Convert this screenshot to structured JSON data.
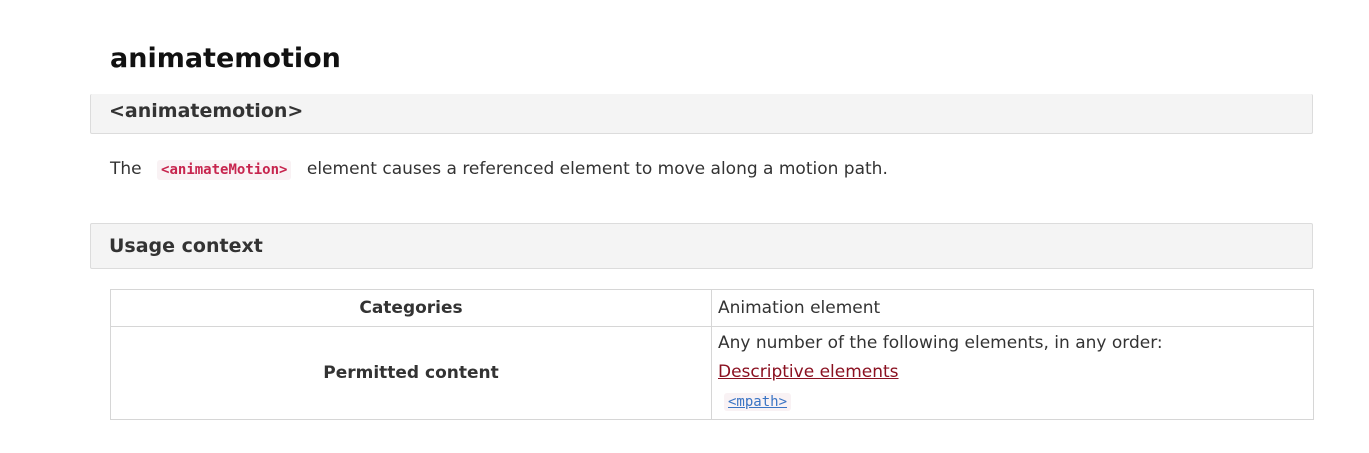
{
  "page": {
    "title": "animatemotion"
  },
  "section1": {
    "heading": "<animatemotion>"
  },
  "intro": {
    "prefix": "The",
    "code": "<animateMotion>",
    "suffix": "element causes a referenced element to move along a motion path."
  },
  "section2": {
    "heading": "Usage context"
  },
  "usage_table": {
    "rows": [
      {
        "header": "Categories",
        "value": "Animation element"
      },
      {
        "header": "Permitted content",
        "intro": "Any number of the following elements, in any order:",
        "link": "Descriptive elements",
        "code": "<mpath>"
      }
    ]
  },
  "colors": {
    "code_text": "#c7254e",
    "code_background": "#f9f2f4",
    "link": "#8a1020",
    "code_link": "#3a74c4",
    "section_background": "#f4f4f4"
  }
}
